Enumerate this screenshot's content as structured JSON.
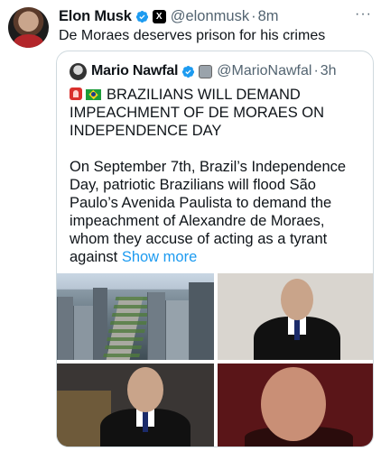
{
  "tweet": {
    "author_name": "Elon Musk",
    "handle": "@elonmusk",
    "separator": "·",
    "time": "8m",
    "text": "De Moraes deserves prison for his crimes",
    "more_icon": "···"
  },
  "quote": {
    "author_name": "Mario Nawfal",
    "handle": "@MarioNawfal",
    "separator": "·",
    "time": "3h",
    "headline": "BRAZILIANS WILL DEMAND IMPEACHMENT OF DE MORAES ON INDEPENDENCE DAY",
    "body": "On September 7th, Brazil’s Independence Day, patriotic Brazilians will flood São Paulo’s Avenida Paulista to demand the impeachment of Alexandre de Moraes, whom they accuse of acting as a tyrant against",
    "show_more": "Show more"
  },
  "colors": {
    "verified": "#1d9bf0",
    "link": "#1d9bf0",
    "muted": "#536471",
    "border": "#cfd9de"
  },
  "icons": [
    "verified-badge-icon",
    "x-logo-badge-icon",
    "more-options-icon",
    "siren-emoji-icon",
    "brazil-flag-icon"
  ]
}
